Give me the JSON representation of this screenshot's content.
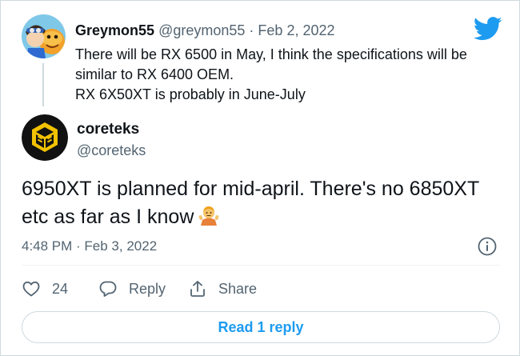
{
  "parent_tweet": {
    "display_name": "Greymon55",
    "handle": "@greymon55",
    "separator": "·",
    "date": "Feb 2, 2022",
    "lines": [
      "There will be RX 6500 in May, I think the specifications will be",
      "similar to RX 6400 OEM.",
      "RX 6X50XT is probably in June-July"
    ]
  },
  "main_tweet": {
    "display_name": "coreteks",
    "handle": "@coreteks",
    "lines": [
      "6950XT is planned for mid-april. There's no 6850XT",
      "etc as far as I know"
    ],
    "timestamp": "4:48 PM · Feb 3, 2022"
  },
  "actions": {
    "like_count": "24",
    "reply_label": "Reply",
    "share_label": "Share"
  },
  "read_reply_label": "Read 1 reply",
  "colors": {
    "brand": "#1d9bf0",
    "text": "#0f1419",
    "secondary": "#536471",
    "border": "#cfd9de"
  },
  "icons": [
    "twitter-bird-icon",
    "info-icon",
    "heart-icon",
    "reply-bubble-icon",
    "share-icon",
    "person-shrugging-emoji"
  ]
}
